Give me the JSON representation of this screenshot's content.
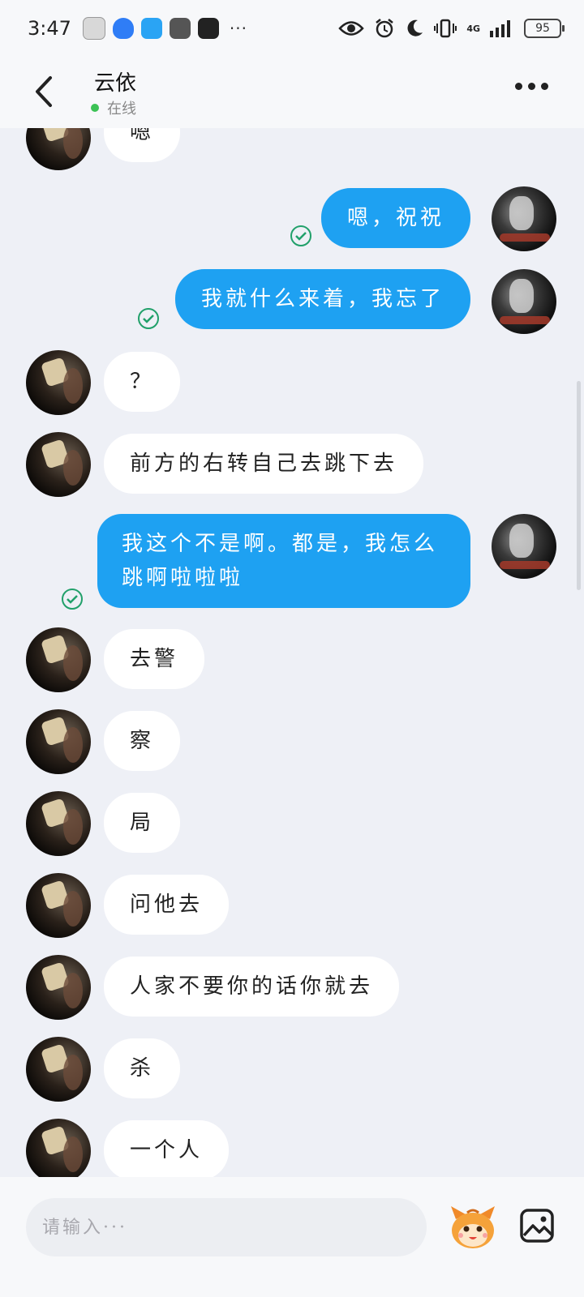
{
  "status_bar": {
    "time": "3:47",
    "more": "···",
    "network": "4G",
    "battery": "95"
  },
  "header": {
    "contact_name": "云依",
    "presence": "在线"
  },
  "messages": [
    {
      "from": "friend",
      "text": "嗯"
    },
    {
      "from": "me",
      "text": "嗯，祝祝",
      "read": true
    },
    {
      "from": "me",
      "text": "我就什么来着，我忘了",
      "read": true
    },
    {
      "from": "friend",
      "text": "？"
    },
    {
      "from": "friend",
      "text": "前方的右转自己去跳下去"
    },
    {
      "from": "me",
      "text": "我这个不是啊。都是，我怎么跳啊啦啦啦",
      "read": true
    },
    {
      "from": "friend",
      "text": "去警"
    },
    {
      "from": "friend",
      "text": "察"
    },
    {
      "from": "friend",
      "text": "局"
    },
    {
      "from": "friend",
      "text": "问他去"
    },
    {
      "from": "friend",
      "text": "人家不要你的话你就去"
    },
    {
      "from": "friend",
      "text": "杀"
    },
    {
      "from": "friend",
      "text": "一个人"
    }
  ],
  "composer": {
    "placeholder": "请输入···"
  },
  "colors": {
    "outgoing_bubble": "#1ea1f2",
    "incoming_bubble": "#ffffff",
    "online_dot": "#3cc255",
    "read_receipt": "#21a06a"
  },
  "icons": [
    "back-arrow-icon",
    "more-icon",
    "read-receipt-icon",
    "emoji-mascot-icon",
    "image-icon"
  ]
}
